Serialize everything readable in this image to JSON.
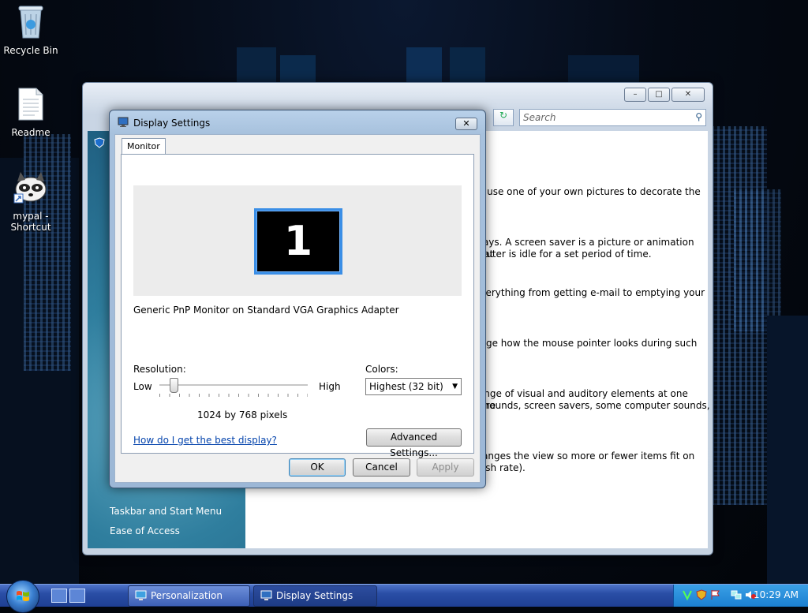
{
  "desktop": {
    "icons": [
      {
        "label": "Recycle Bin"
      },
      {
        "label": "Readme"
      },
      {
        "label_line1": "mypal -",
        "label_line2": "Shortcut"
      }
    ]
  },
  "control_panel": {
    "search_placeholder": "Search",
    "sidebar_links": [
      "Taskbar and Start Menu",
      "Ease of Access"
    ],
    "content": [
      "or use one of your own pictures to decorate the",
      "plays. A screen saver is a picture or animation that",
      "nputer is idle for a set period of time.",
      "everything from getting e-mail to emptying your",
      "ange how the mouse pointer looks during such",
      "range of visual and auditory elements at one time",
      "kgrounds, screen savers, some computer sounds,",
      "Adjust your monitor resolution, which changes the view so more or fewer items fit on the screen.",
      "You can also control monitor flicker (refresh rate)."
    ]
  },
  "dialog": {
    "title": "Display Settings",
    "tab": "Monitor",
    "monitor_number": "1",
    "monitor_name": "Generic PnP Monitor on Standard VGA Graphics Adapter",
    "resolution_label": "Resolution:",
    "low_label": "Low",
    "high_label": "High",
    "resolution_value": "1024 by 768 pixels",
    "resolution_slider_fraction": 0.1,
    "colors_label": "Colors:",
    "colors_value": "Highest (32 bit)",
    "help_link": "How do I get the best display?",
    "advanced_button": "Advanced Settings...",
    "ok_button": "OK",
    "cancel_button": "Cancel",
    "apply_button": "Apply"
  },
  "taskbar": {
    "tasks": [
      "Personalization",
      "Display Settings"
    ],
    "clock": "10:29 AM"
  },
  "colors": {
    "taskbar": "#2a4ea6",
    "dialog_frame": "#a7c1dd",
    "link": "#0645ad"
  }
}
